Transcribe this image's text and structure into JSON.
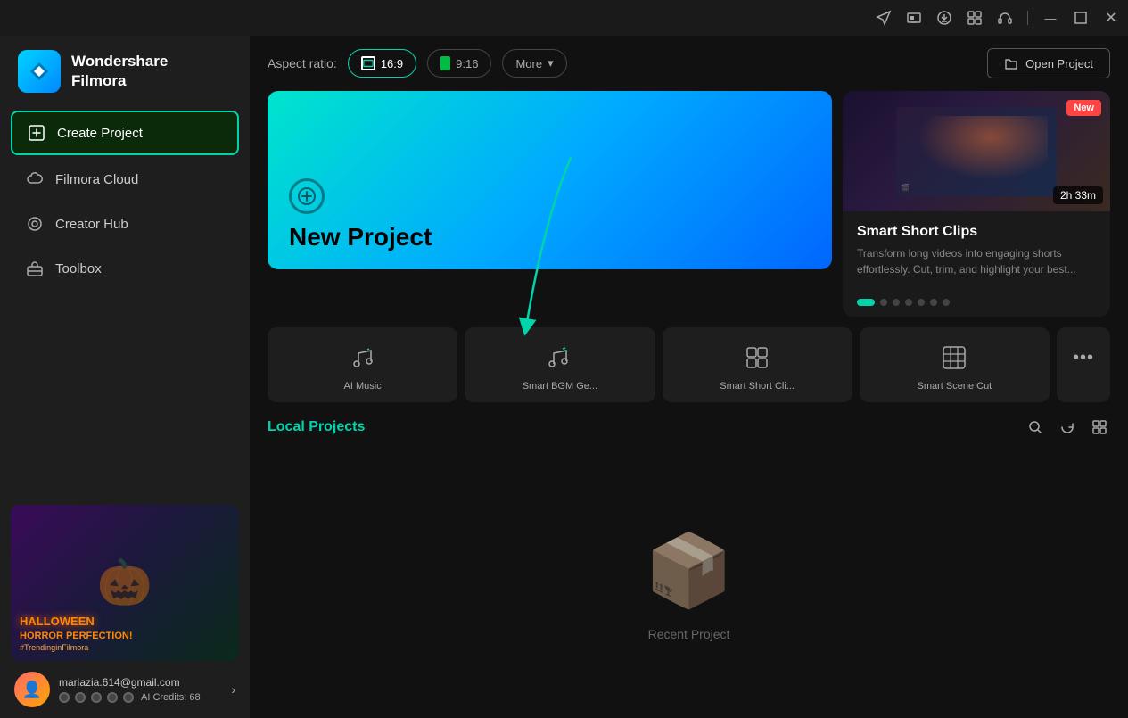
{
  "titlebar": {
    "icons": [
      "send-icon",
      "screen-icon",
      "download-icon",
      "grid-icon",
      "headset-icon",
      "minimize-icon",
      "maximize-icon",
      "close-icon"
    ]
  },
  "sidebar": {
    "logo": {
      "name": "Wondershare Filmora",
      "line1": "Wondershare",
      "line2": "Filmora"
    },
    "nav": [
      {
        "id": "create-project",
        "label": "Create Project",
        "active": true
      },
      {
        "id": "filmora-cloud",
        "label": "Filmora Cloud",
        "active": false
      },
      {
        "id": "creator-hub",
        "label": "Creator Hub",
        "active": false
      },
      {
        "id": "toolbox",
        "label": "Toolbox",
        "active": false
      }
    ],
    "banner": {
      "title": "HALLOWEEN",
      "subtitle": "HORROR PERFECTION!",
      "tag": "#TrendinginFilmora"
    },
    "user": {
      "email": "mariazia.614@gmail.com",
      "credits_label": "AI Credits: 68"
    }
  },
  "topbar": {
    "aspect_label": "Aspect ratio:",
    "aspect_16_9": "16:9",
    "aspect_9_16": "9:16",
    "more_label": "More",
    "open_project_label": "Open Project"
  },
  "new_project": {
    "title": "New Project"
  },
  "feature_card": {
    "new_badge": "New",
    "duration": "2h 33m",
    "title": "Smart Short Clips",
    "description": "Transform long videos into engaging shorts effortlessly. Cut, trim, and highlight your best..."
  },
  "quick_actions": [
    {
      "id": "ai-music",
      "label": "AI Music",
      "icon": "♪"
    },
    {
      "id": "smart-bgm",
      "label": "Smart BGM Ge...",
      "icon": "♫"
    },
    {
      "id": "smart-short",
      "label": "Smart Short Cli...",
      "icon": "⊞"
    },
    {
      "id": "smart-scene",
      "label": "Smart Scene Cut",
      "icon": "⊡"
    },
    {
      "id": "more-actions",
      "label": "···",
      "icon": "···"
    }
  ],
  "local_projects": {
    "title": "Local Projects",
    "empty_text": "Recent Project"
  },
  "carousel_dots": 7
}
